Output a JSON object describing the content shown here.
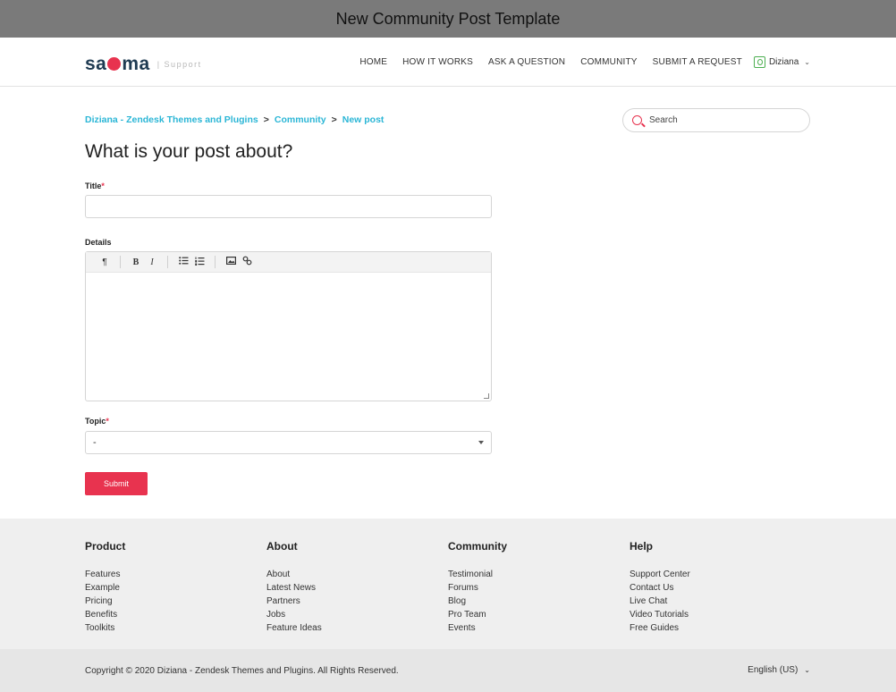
{
  "banner": {
    "title": "New Community Post Template"
  },
  "header": {
    "logo_text": "sagma",
    "logo_subtitle": "| Support",
    "nav": [
      "HOME",
      "HOW IT WORKS",
      "ASK A QUESTION",
      "COMMUNITY",
      "SUBMIT A REQUEST"
    ],
    "user_name": "Diziana"
  },
  "breadcrumb": [
    "Diziana - Zendesk Themes and Plugins",
    "Community",
    "New post"
  ],
  "breadcrumb_separator": ">",
  "search": {
    "placeholder": "Search"
  },
  "page": {
    "title": "What is your post about?"
  },
  "form": {
    "title_label": "Title",
    "details_label": "Details",
    "topic_label": "Topic",
    "required_mark": "*",
    "topic_value": "-",
    "submit_label": "Submit",
    "toolbar_icons": [
      "paragraph-icon",
      "bold-icon",
      "italic-icon",
      "bulleted-list-icon",
      "numbered-list-icon",
      "image-icon",
      "link-icon"
    ]
  },
  "footer": {
    "columns": [
      {
        "heading": "Product",
        "links": [
          "Features",
          "Example",
          "Pricing",
          "Benefits",
          "Toolkits"
        ]
      },
      {
        "heading": "About",
        "links": [
          "About",
          "Latest News",
          "Partners",
          "Jobs",
          "Feature Ideas"
        ]
      },
      {
        "heading": "Community",
        "links": [
          "Testimonial",
          "Forums",
          "Blog",
          "Pro Team",
          "Events"
        ]
      },
      {
        "heading": "Help",
        "links": [
          "Support Center",
          "Contact Us",
          "Live Chat",
          "Video Tutorials",
          "Free Guides"
        ]
      }
    ],
    "copyright": "Copyright © 2020 Diziana - Zendesk Themes and Plugins. All Rights Reserved.",
    "language": "English (US)"
  },
  "colors": {
    "accent": "#e8334f",
    "link": "#2bb6d6",
    "banner": "#7a7a7a",
    "footer_bg": "#efefef"
  }
}
